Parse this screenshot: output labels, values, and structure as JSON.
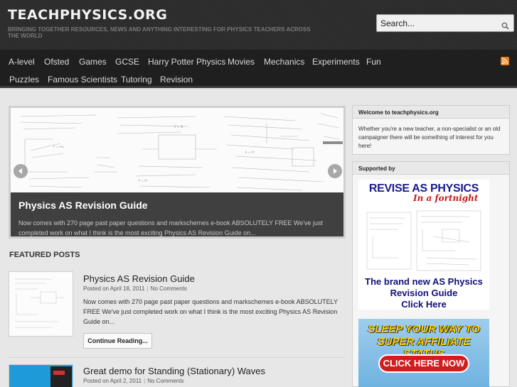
{
  "site": {
    "title": "TEACHPHYSICS.ORG",
    "tagline": "BRINGING TOGETHER RESOURCES, NEWS AND ANYTHING INTERESTING FOR PHYSICS TEACHERS ACROSS THE WORLD"
  },
  "search": {
    "placeholder": "Search...",
    "icon": "search-icon"
  },
  "nav": {
    "row1": [
      "A-level",
      "Ofsted",
      "Games",
      "GCSE",
      "Harry Potter Physics",
      "Movies",
      "Mechanics",
      "Experiments",
      "Fun"
    ],
    "row2": [
      "Puzzles",
      "Famous Scientists",
      "Tutoring",
      "Revision"
    ],
    "rss_icon": "rss-icon"
  },
  "slider": {
    "title": "Physics AS Revision Guide",
    "excerpt": "Now comes with 270 page past paper questions and markschemes e-book ABSOLUTELY FREE We've just completed work on what I think is the most exciting Physics AS Revision Guide on...",
    "prev_icon": "chevron-left-icon",
    "next_icon": "chevron-right-icon"
  },
  "featured": {
    "heading": "FEATURED POSTS",
    "posts": [
      {
        "title": "Physics AS Revision Guide",
        "date": "Posted on April 18, 2011",
        "comments": "No Comments",
        "excerpt": "Now comes with 270 page past paper questions and markschemes e-book ABSOLUTELY FREE We've just completed work on what I think is the most exciting Physics AS Revision Guide on...",
        "continue": "Continue Reading..."
      },
      {
        "title": "Great demo for Standing (Stationary) Waves",
        "date": "Posted on April 2, 2011",
        "comments": "No Comments"
      }
    ]
  },
  "sidebar": {
    "welcome": {
      "title": "Welcome to teachphysics.org",
      "text": "Whether you're a new teacher, a non-specialist or an old campaigner there will be something of interest for you here!"
    },
    "supported": {
      "title": "Supported by"
    },
    "ad_revise": {
      "title": "REVISE AS PHYSICS",
      "subtitle": "In a fortnight",
      "line1": "The brand new AS Physics",
      "line2": "Revision Guide",
      "line3": "Click Here"
    },
    "ad_sleep": {
      "line1": "SLEEP YOUR WAY TO",
      "line2": "SUPER AFFILIATE STATUS",
      "button": "CLICK HERE NOW"
    }
  },
  "colors": {
    "header_bg": "#2b2b2b",
    "nav_bg": "#1f1f1f",
    "accent_rss": "#e8801a",
    "ad_blue": "#1a1a8c",
    "ad_red": "#c41a1a"
  }
}
